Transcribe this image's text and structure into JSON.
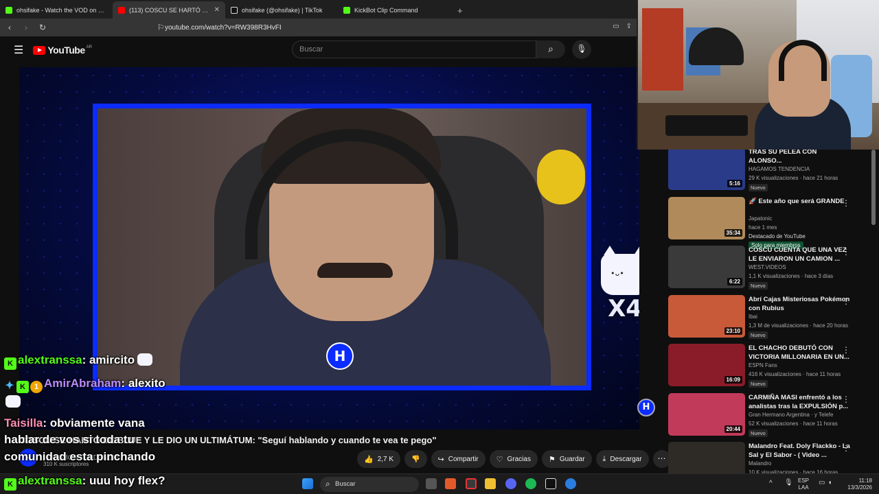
{
  "browser": {
    "tabs": [
      {
        "title": "ohsifake - Watch the VOD on Kick",
        "color": "#53fc18"
      },
      {
        "title": "(113) COSCU SE HARTÓ DE B",
        "color": "#ff0000"
      },
      {
        "title": "ohsifake (@ohsifake) | TikTok",
        "color": "#ffffff"
      },
      {
        "title": "KickBot Clip Command",
        "color": "#53fc18"
      }
    ],
    "url": "youtube.com/watch?v=RW398R3HvFI"
  },
  "youtube": {
    "logo_text": "YouTube",
    "country": "AR",
    "search_placeholder": "Buscar"
  },
  "player": {
    "logo_letter": "H",
    "emote_multiplier": "X4"
  },
  "chat": [
    {
      "user": "alextranssa",
      "message": "amircito"
    },
    {
      "user": "AmirAbraham",
      "message": "alexito"
    },
    {
      "user": "Taisilla",
      "message": "obviamente vana"
    },
    {
      "user": "",
      "message": "hablar de vos si toda tu"
    },
    {
      "user": "",
      "message": "comunidad esta pinchando"
    },
    {
      "user": "alextranssa",
      "message": "uuu hoy flex?"
    }
  ],
  "video": {
    "title": "COSCU SE HARTÓ DE BLUE Y LE DIO UN ULTIMÁTUM: \"Seguí hablando y cuando te vea te pego\"",
    "channel": "HAGAMOS TENDENCIA",
    "subscribers": "310 K suscriptores",
    "likes": "2,7 K",
    "actions": {
      "share": "Compartir",
      "thanks": "Gracias",
      "save": "Guardar",
      "download": "Descargar"
    }
  },
  "recommendations": [
    {
      "title": "TRAS SU PELEA CON ALONSO...",
      "channel": "HAGAMOS TENDENCIA",
      "meta": "29 K visualizaciones · hace 21 horas",
      "duration": "5:16",
      "badge": "Nuevo",
      "thumb_color": "#2a3b8a"
    },
    {
      "title": "🚀 Este año que será GRANDE",
      "channel": "Japatonic",
      "meta": "hace 1 mes",
      "extra": "Destacado de YouTube",
      "members": "Solo para miembros",
      "duration": "35:34",
      "thumb_color": "#b08a5a"
    },
    {
      "title": "COSCU CUENTA QUE UNA VEZ LE ENVIARON UN CAMION ...",
      "channel": "WEST.VIDEOS",
      "meta": "1,1 K visualizaciones · hace 3 días",
      "duration": "6:22",
      "badge": "Nuevo",
      "thumb_color": "#3a3a3a"
    },
    {
      "title": "Abrí Cajas Misteriosas Pokémon con Rubius",
      "channel": "Ibai",
      "meta": "1,3 M de visualizaciones · hace 20 horas",
      "duration": "23:10",
      "badge": "Nuevo",
      "thumb_color": "#c85a3a"
    },
    {
      "title": "EL CHACHO DEBUTÓ CON VICTORIA MILLONARIA EN UN...",
      "channel": "ESPN Fans",
      "meta": "416 K visualizaciones · hace 11 horas",
      "duration": "16:09",
      "badge": "Nuevo",
      "thumb_color": "#8a1c2a"
    },
    {
      "title": "CARMIÑA MASI enfrentó a los analistas tras la EXPULSIÓN p...",
      "channel": "Gran Hermano Argentina · y Telefe",
      "meta": "52 K visualizaciones · hace 11 horas",
      "duration": "20:44",
      "badge": "Nuevo",
      "thumb_color": "#c23a5a"
    },
    {
      "title": "Malandro Feat. Doly Flackko - La Sal y El Sabor - ( Video ...",
      "channel": "Malandro",
      "meta": "10 K visualizaciones · hace 16 horas",
      "duration": "3:02",
      "badge": "",
      "thumb_color": "#2e2a26"
    }
  ],
  "taskbar": {
    "search": "Buscar",
    "lang": "ESP",
    "region": "LAA",
    "time": "11:18",
    "date": "13/3/2026"
  }
}
